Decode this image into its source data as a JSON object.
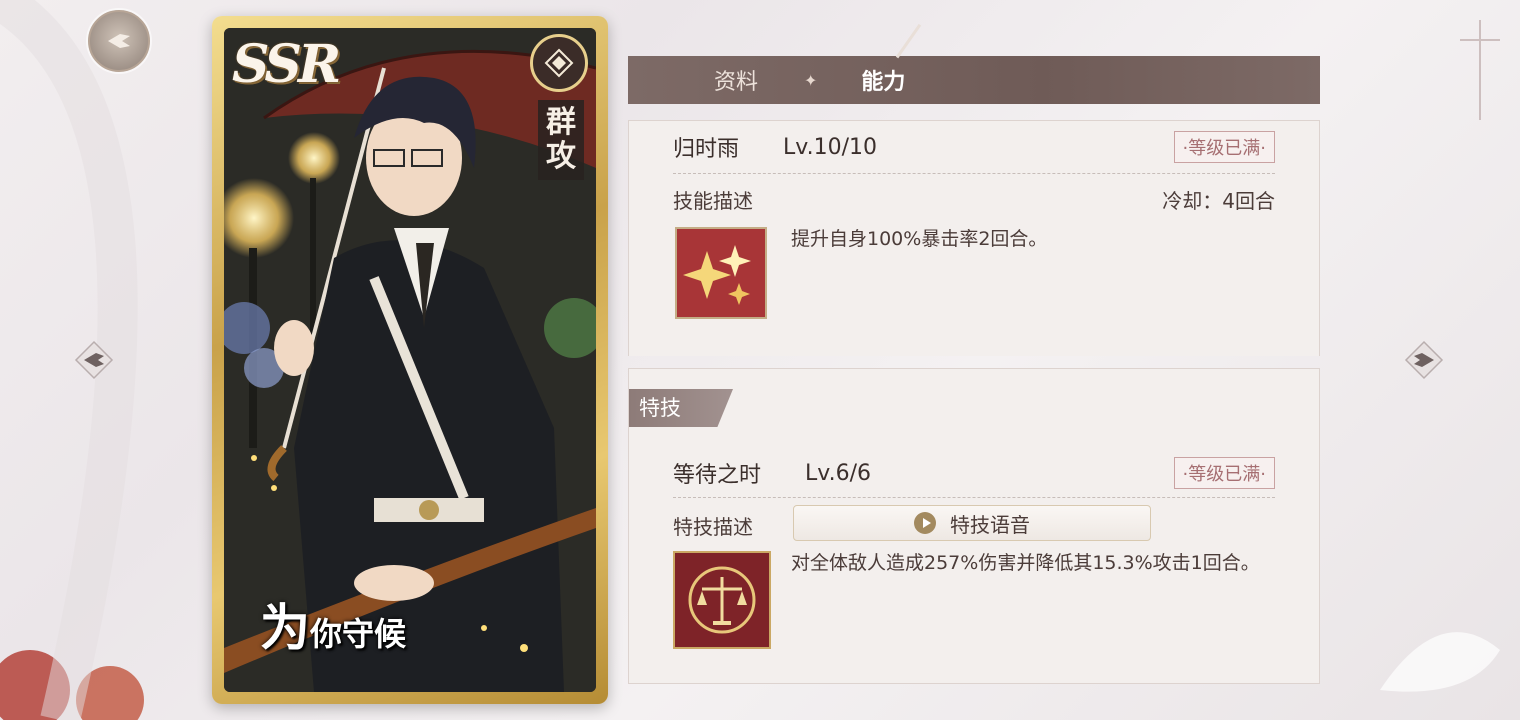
{
  "nav": {
    "back_icon": "quill-back-icon",
    "prev_icon": "chevron-left-icon",
    "next_icon": "chevron-right-icon"
  },
  "card": {
    "rarity": "SSR",
    "type_label": "群攻",
    "title_big": "为",
    "title_rest": "你守候"
  },
  "tabs": {
    "profile": "资料",
    "separator": "✦",
    "ability": "能力"
  },
  "skill": {
    "name": "归时雨",
    "level": "Lv.10/10",
    "max_badge": "·等级已满·",
    "desc_label": "技能描述",
    "cooldown": "冷却：4回合",
    "description": "提升自身100%暴击率2回合。",
    "icon": "sparkle-crit-icon"
  },
  "special": {
    "section_label": "特技",
    "name": "等待之时",
    "level": "Lv.6/6",
    "max_badge": "·等级已满·",
    "desc_label": "特技描述",
    "voice_button": "特技语音",
    "description": "对全体敌人造成257%伤害并降低其15.3%攻击1回合。",
    "icon": "scales-icon"
  },
  "colors": {
    "accent_gold": "#c9a24a",
    "tab_bar": "#7d6a66",
    "skill_icon_red": "#9e3335"
  }
}
